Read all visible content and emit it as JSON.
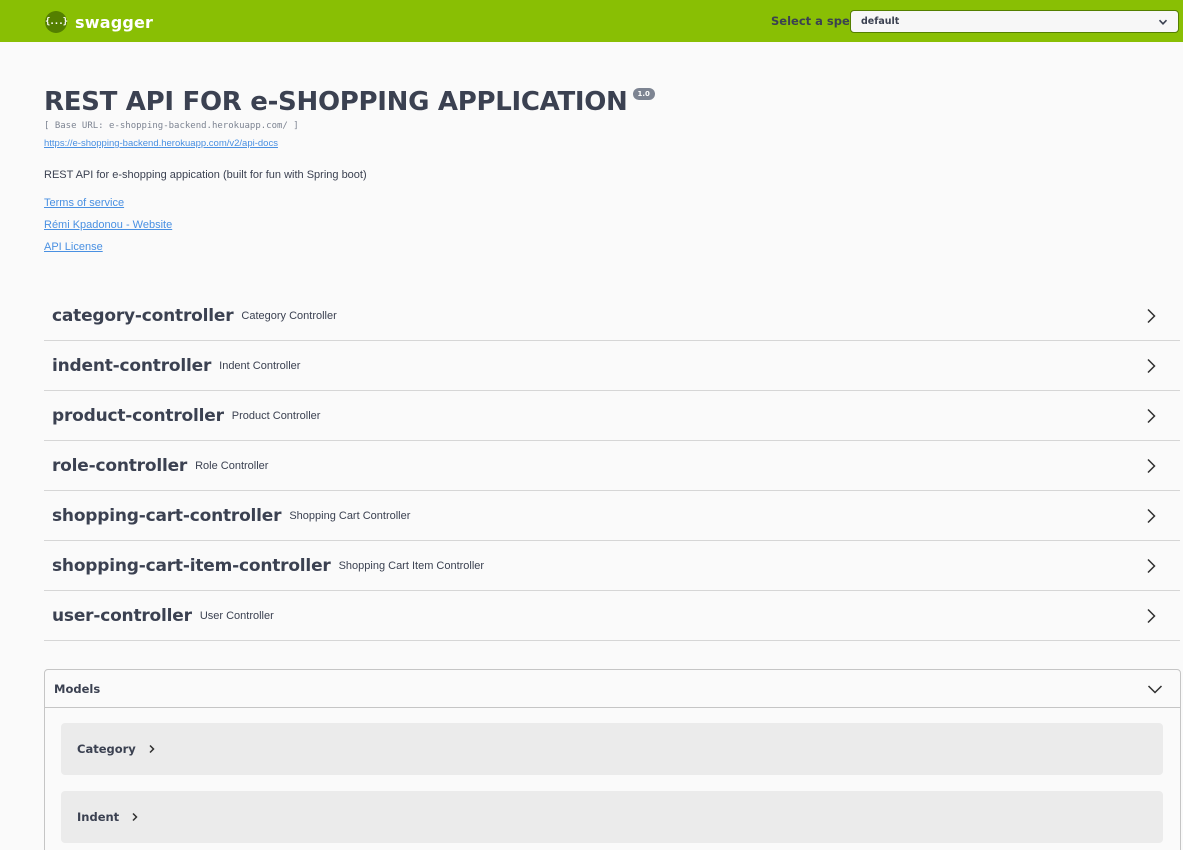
{
  "topbar": {
    "logo_icon_text": "{...}",
    "logo_text": "swagger",
    "spec_label": "Select a spec",
    "spec_value": "default",
    "accent_color": "#89bf04"
  },
  "info": {
    "title": "REST API FOR e-SHOPPING APPLICATION",
    "version": "1.0",
    "base_url": "[ Base URL: e-shopping-backend.herokuapp.com/ ]",
    "docs_link": "https://e-shopping-backend.herokuapp.com/v2/api-docs",
    "description": "REST API for e-shopping appication (built for fun with Spring boot)",
    "terms": "Terms of service",
    "contact": "Rémi Kpadonou - Website",
    "license": "API License"
  },
  "controllers": [
    {
      "name": "category-controller",
      "desc": "Category Controller"
    },
    {
      "name": "indent-controller",
      "desc": "Indent Controller"
    },
    {
      "name": "product-controller",
      "desc": "Product Controller"
    },
    {
      "name": "role-controller",
      "desc": "Role Controller"
    },
    {
      "name": "shopping-cart-controller",
      "desc": "Shopping Cart Controller"
    },
    {
      "name": "shopping-cart-item-controller",
      "desc": "Shopping Cart Item Controller"
    },
    {
      "name": "user-controller",
      "desc": "User Controller"
    }
  ],
  "models": {
    "label": "Models",
    "items": [
      {
        "name": "Category"
      },
      {
        "name": "Indent"
      }
    ]
  }
}
